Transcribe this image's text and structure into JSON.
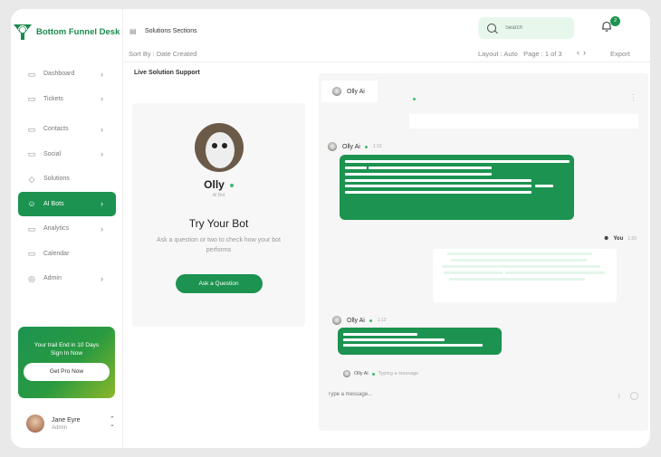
{
  "app": {
    "brand": "Bottom Funnel Desk",
    "accent": "#1c9350"
  },
  "sidebar": {
    "items": [
      {
        "label": "Dashboard",
        "icon": "chart-icon",
        "chevron": true
      },
      {
        "label": "Tickets",
        "icon": "ticket-icon",
        "chevron": true
      },
      {
        "label": "Contacts",
        "icon": "contacts-icon",
        "chevron": true
      },
      {
        "label": "Social",
        "icon": "social-icon",
        "chevron": true
      },
      {
        "label": "Solutions",
        "icon": "solutions-icon",
        "chevron": false
      },
      {
        "label": "AI Bots",
        "icon": "bot-icon",
        "chevron": true,
        "active": true
      },
      {
        "label": "Analytics",
        "icon": "analytics-icon",
        "chevron": true
      },
      {
        "label": "Calendar",
        "icon": "calendar-icon",
        "chevron": false
      },
      {
        "label": "Admin",
        "icon": "admin-icon",
        "chevron": true
      }
    ],
    "promo": {
      "line1": "Your trail End in 10 Days",
      "line2": "Sign In Now",
      "button": "Get Pro Now"
    },
    "user": {
      "name": "Jane Eyre",
      "role": "Admin"
    }
  },
  "header": {
    "section_title": "Solutions Sections",
    "search_placeholder": "Search",
    "notification_count": "2",
    "sort": "Sort By : Date Created",
    "layout": "Layout : Auto",
    "page": "Page : 1 of 3",
    "export": "Export"
  },
  "main": {
    "panel_title": "Live Solution Support",
    "bot": {
      "name": "Olly",
      "sub": "AI Bot",
      "try_title": "Try Your Bot",
      "try_desc": "Ask a question or two to check how your bot performs",
      "ask_button": "Ask a Question"
    },
    "chat": {
      "header_name": "Olly Ai",
      "messages": [
        {
          "sender": "Olly Ai",
          "time": "1:12"
        },
        {
          "sender": "You",
          "time": "1:20"
        },
        {
          "sender": "Olly Ai",
          "time": "1:12"
        }
      ],
      "typing_name": "Olly Ai",
      "typing_text": "Typing a message",
      "input_placeholder": "Type a message..."
    }
  }
}
